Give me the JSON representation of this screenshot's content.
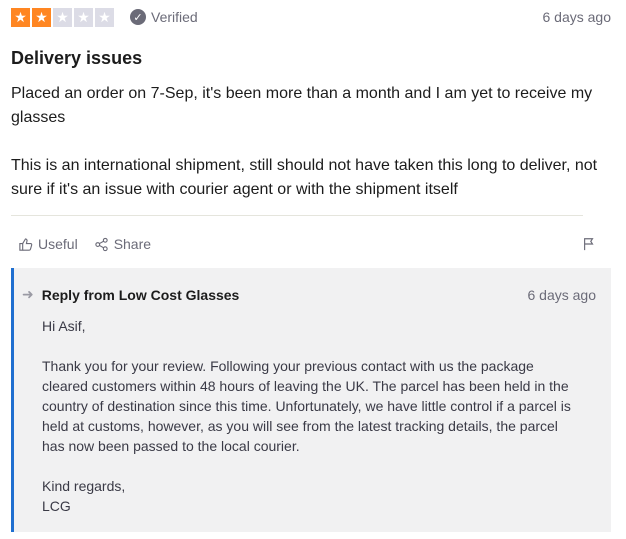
{
  "review": {
    "rating": 2,
    "max_rating": 5,
    "verified_label": "Verified",
    "date": "6 days ago",
    "title": "Delivery issues",
    "paragraphs": [
      "Placed an order on 7-Sep, it's been more than a month and I am yet to receive my glasses",
      "This is an international shipment, still should not have taken this long to deliver, not sure if it's an issue with courier agent or with the shipment itself"
    ],
    "useful_label": "Useful",
    "share_label": "Share"
  },
  "reply": {
    "from_label": "Reply from Low Cost Glasses",
    "date": "6 days ago",
    "greeting": "Hi Asif,",
    "body": "Thank you for your review. Following your previous contact with us the package cleared customers within 48 hours of leaving the UK. The parcel has been held in the country of destination since this time. Unfortunately, we have little control if a parcel is held at customs, however, as you will see from the latest tracking details, the parcel has now been passed to the local courier.",
    "signoff_line1": "Kind regards,",
    "signoff_line2": "LCG"
  },
  "colors": {
    "star_filled": "#ff8622",
    "star_empty": "#dcdce6",
    "reply_accent": "#1f6fd0"
  },
  "icons": {
    "star": "star-icon",
    "verified": "check-circle-icon",
    "useful": "thumbs-up-icon",
    "share": "share-icon",
    "flag": "flag-icon",
    "reply": "reply-arrow-icon"
  }
}
